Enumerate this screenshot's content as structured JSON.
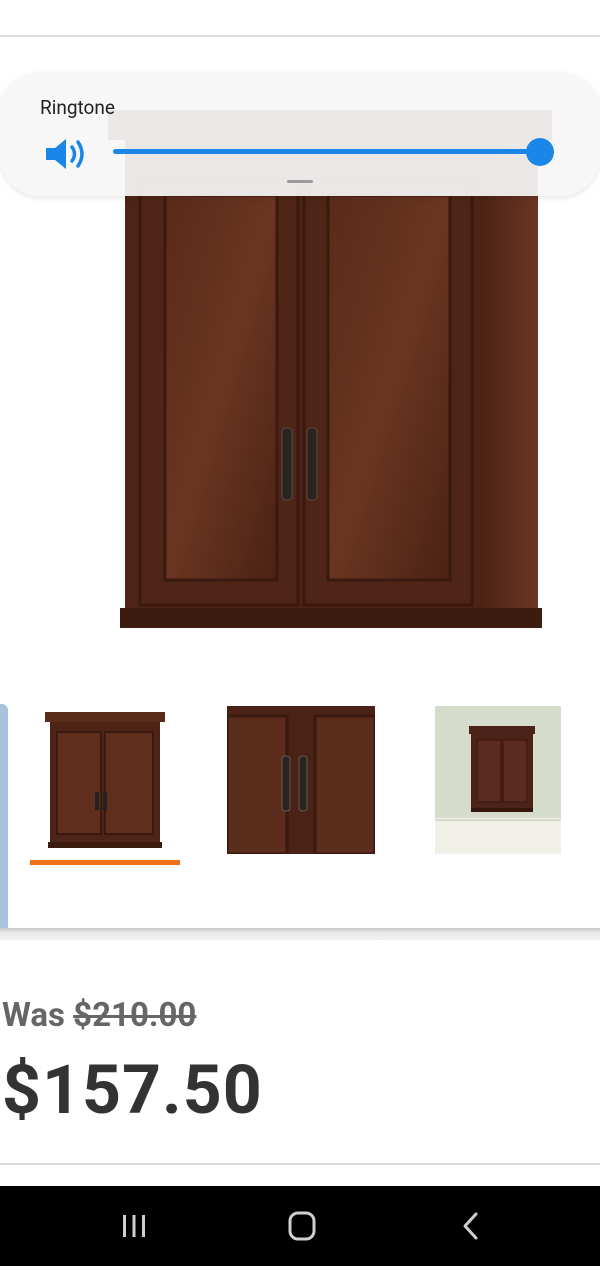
{
  "volume_panel": {
    "title": "Ringtone",
    "level_fraction": 1.0,
    "icon": "speaker-volume-icon",
    "accent": "#1a86e8"
  },
  "product": {
    "main_image": "wall-cabinet-image",
    "thumbnails": [
      {
        "name": "cabinet-front-thumb",
        "selected": true
      },
      {
        "name": "cabinet-handles-closeup-thumb",
        "selected": false
      },
      {
        "name": "cabinet-on-wall-thumb",
        "selected": false
      }
    ],
    "selected_color": "#f06f19"
  },
  "pricing": {
    "was_label": "Was",
    "was_price": "$210.00",
    "current_price": "$157.50"
  },
  "navbar": {
    "recent_icon": "recent-apps-icon",
    "home_icon": "home-icon",
    "back_icon": "back-icon"
  }
}
